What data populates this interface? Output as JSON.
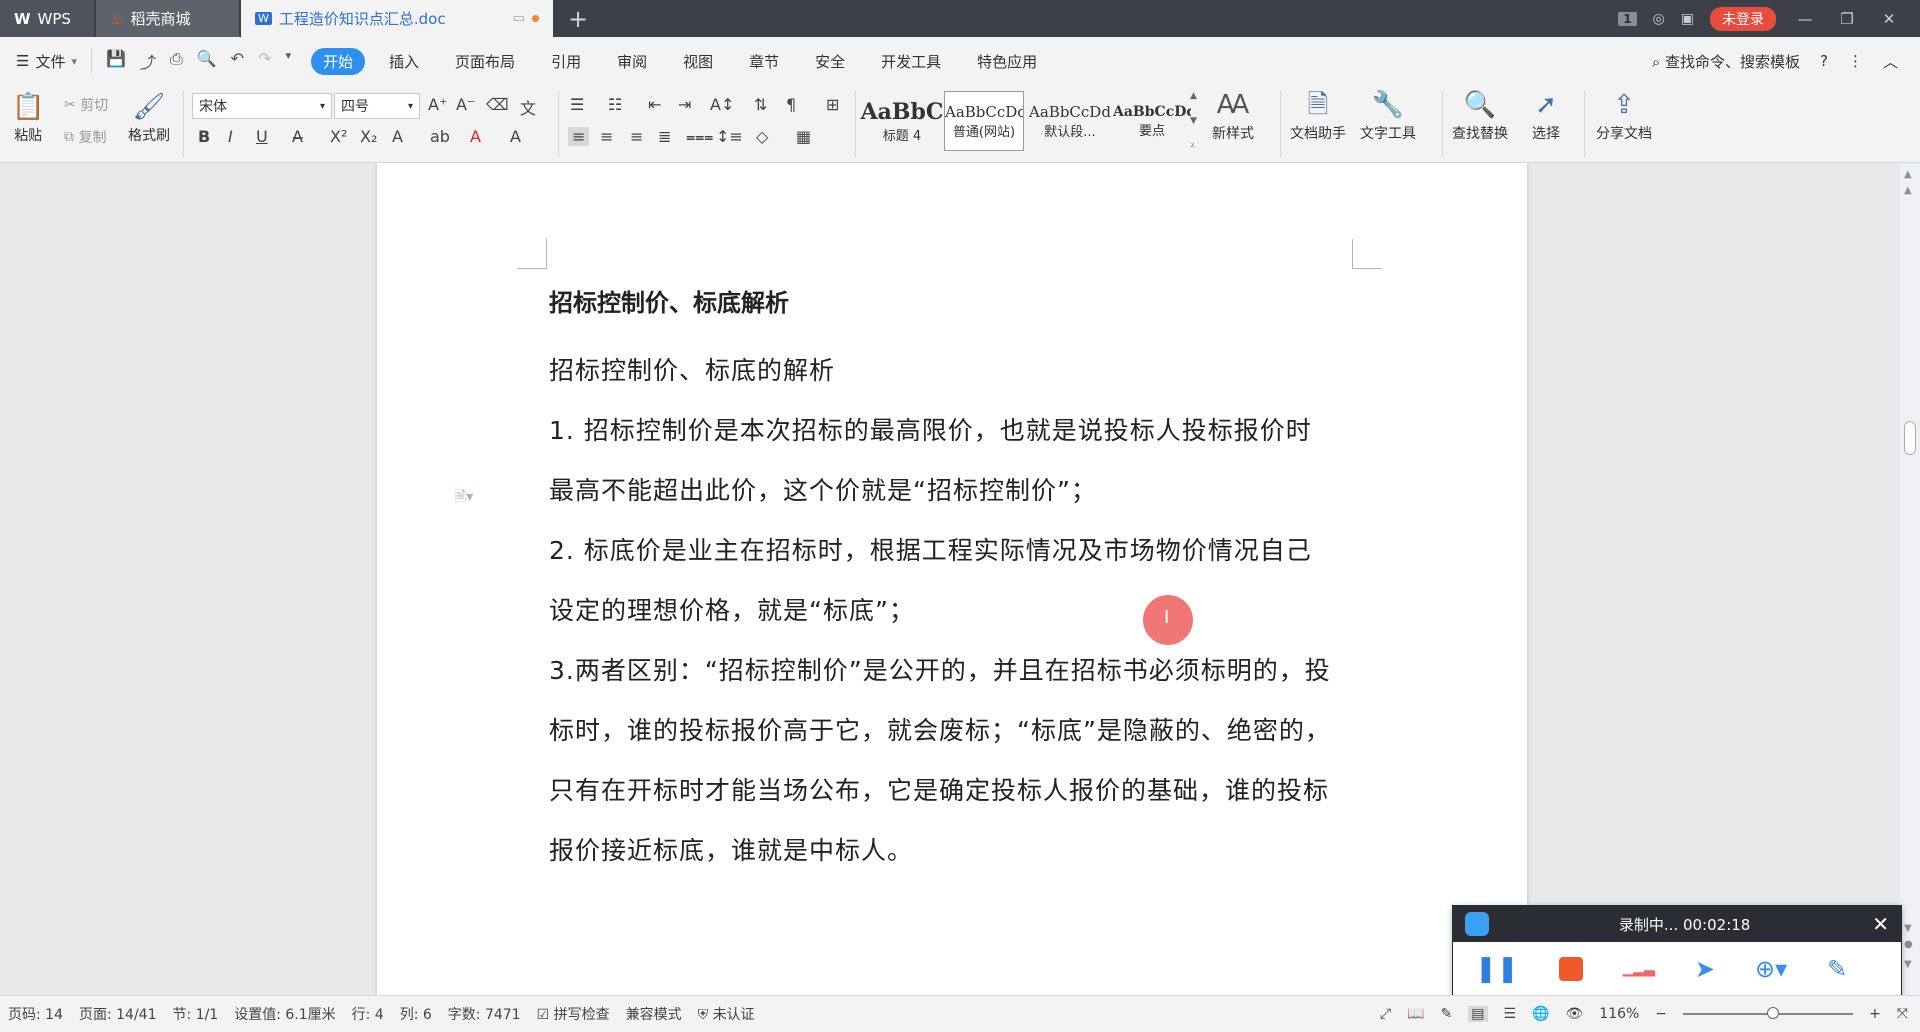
{
  "tabs": {
    "wps": "WPS",
    "shop": "稻壳商城",
    "doc": "工程造价知识点汇总.doc"
  },
  "titlebar": {
    "window_count": "1",
    "login": "未登录"
  },
  "menu": {
    "file": "文件",
    "items": [
      "开始",
      "插入",
      "页面布局",
      "引用",
      "审阅",
      "视图",
      "章节",
      "安全",
      "开发工具",
      "特色应用"
    ],
    "search": "查找命令、搜索模板"
  },
  "ribbon": {
    "paste": "粘贴",
    "cut": "剪切",
    "copy": "复制",
    "format_painter": "格式刷",
    "font_name": "宋体",
    "font_size": "四号",
    "styles": [
      {
        "preview": "AaBbC",
        "label": "标题 4"
      },
      {
        "preview": "AaBbCcDd",
        "label": "普通(网站)"
      },
      {
        "preview": "AaBbCcDd",
        "label": "默认段..."
      },
      {
        "preview": "AaBbCcDd",
        "label": "要点"
      }
    ],
    "new_style": "新样式",
    "doc_helper": "文档助手",
    "text_tools": "文字工具",
    "find_replace": "查找替换",
    "select": "选择",
    "share": "分享文档"
  },
  "document": {
    "heading": "招标控制价、标底解析",
    "lines": [
      "招标控制价、标底的解析",
      "1.  招标控制价是本次招标的最高限价，也就是说投标人投标报价时",
      "最高不能超出此价，这个价就是“招标控制价”；",
      "2.  标底价是业主在招标时，根据工程实际情况及市场物价情况自己",
      "设定的理想价格，就是“标底”；",
      "3.两者区别：“招标控制价”是公开的，并且在招标书必须标明的，投",
      "标时，谁的投标报价高于它，就会废标；“标底”是隐蔽的、绝密的，",
      "只有在开标时才能当场公布，它是确定投标人报价的基础，谁的投标",
      "报价接近标底，谁就是中标人。"
    ]
  },
  "recorder": {
    "status": "录制中... 00:02:18"
  },
  "statusbar": {
    "page_code": "页码: 14",
    "page": "页面: 14/41",
    "section": "节: 1/1",
    "setting": "设置值: 6.1厘米",
    "row": "行: 4",
    "col": "列: 6",
    "words": "字数: 7471",
    "spell": "拼写检查",
    "compat": "兼容模式",
    "cert": "未认证",
    "zoom": "116%"
  }
}
